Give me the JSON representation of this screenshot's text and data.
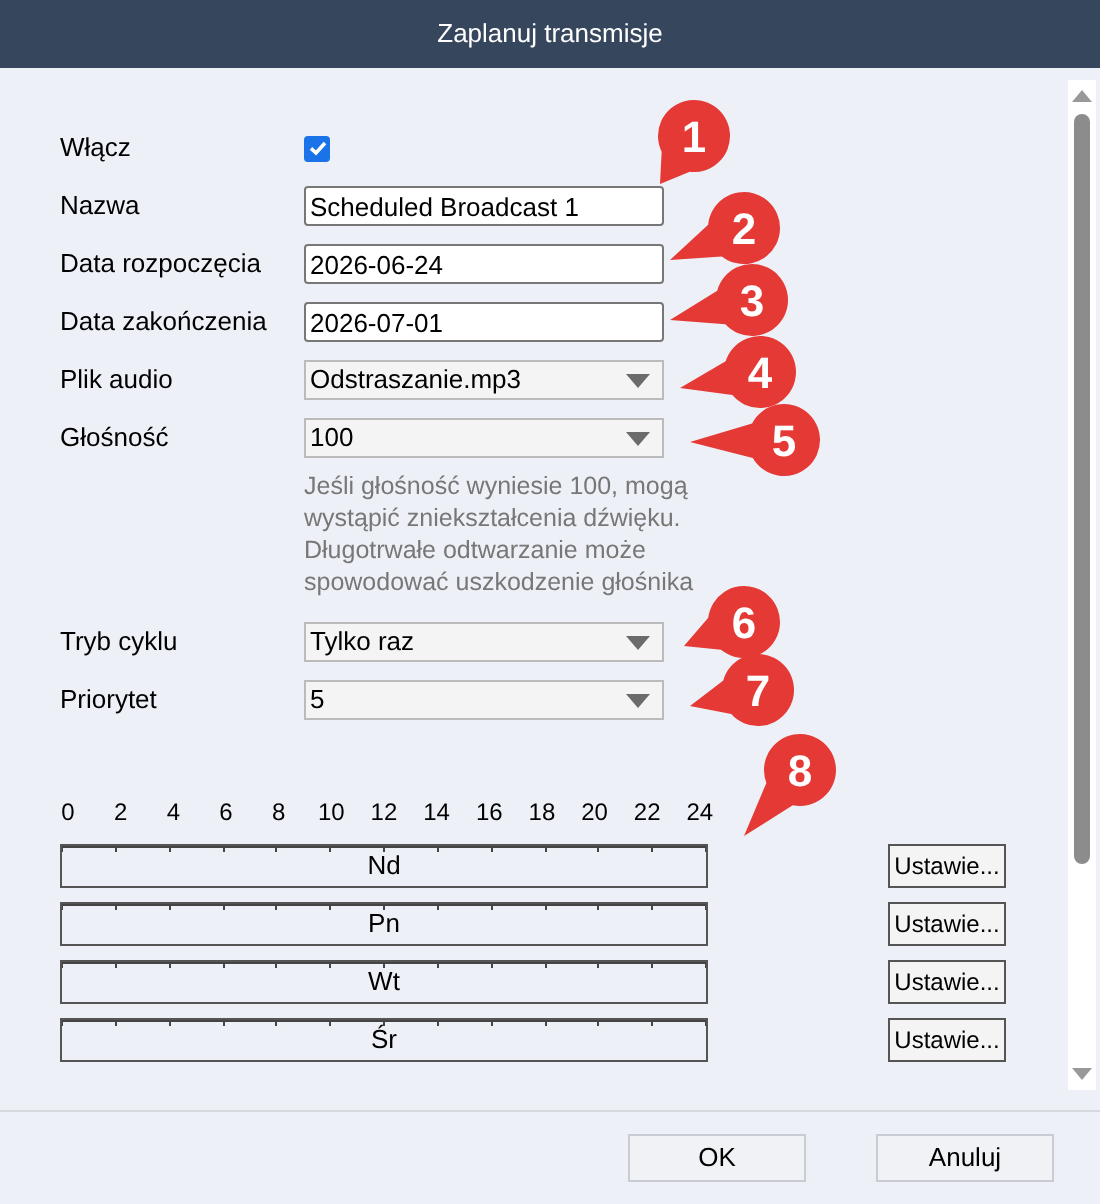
{
  "window": {
    "title": "Zaplanuj transmisje"
  },
  "form": {
    "enable": {
      "label": "Włącz",
      "checked": true
    },
    "fields": [
      {
        "kind": "text",
        "label": "Nazwa",
        "value": "Scheduled Broadcast 1"
      },
      {
        "kind": "text",
        "label": "Data rozpoczęcia",
        "value": "2026-06-24"
      },
      {
        "kind": "text",
        "label": "Data zakończenia",
        "value": "2026-07-01"
      },
      {
        "kind": "select",
        "label": "Plik audio",
        "value": "Odstraszanie.mp3"
      },
      {
        "kind": "select",
        "label": "Głośność",
        "value": "100"
      },
      {
        "kind": "note",
        "text": "Jeśli głośność wyniesie 100, mogą wystąpić zniekształcenia dźwięku. Długotrwałe odtwarzanie może spowodować uszkodzenie głośnika"
      },
      {
        "kind": "select",
        "label": "Tryb cyklu",
        "value": "Tylko raz"
      },
      {
        "kind": "select",
        "label": "Priorytet",
        "value": "5"
      }
    ]
  },
  "timeline": {
    "hours": [
      "0",
      "2",
      "4",
      "6",
      "8",
      "10",
      "12",
      "14",
      "16",
      "18",
      "20",
      "22",
      "24"
    ],
    "days": [
      {
        "label": "Nd",
        "button": "Ustawie..."
      },
      {
        "label": "Pn",
        "button": "Ustawie..."
      },
      {
        "label": "Wt",
        "button": "Ustawie..."
      },
      {
        "label": "Śr",
        "button": "Ustawie..."
      }
    ]
  },
  "buttons": [
    "OK",
    "Anuluj"
  ],
  "callouts": [
    "1",
    "2",
    "3",
    "4",
    "5",
    "6",
    "7",
    "8"
  ]
}
